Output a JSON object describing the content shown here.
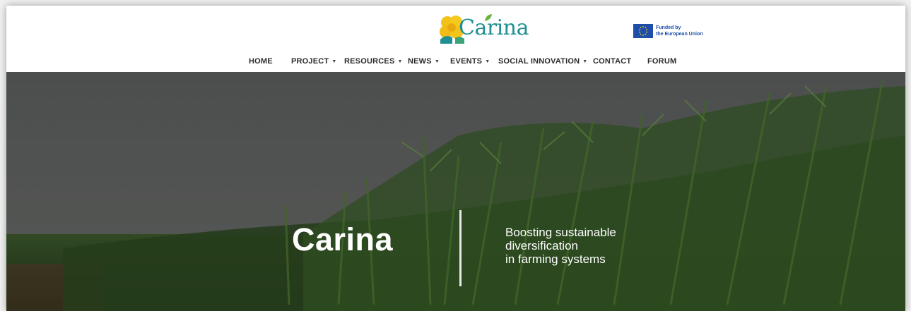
{
  "header": {
    "logo_text": "Carina",
    "eu_badge": {
      "line1": "Funded by",
      "line2": "the European Union"
    }
  },
  "nav": {
    "items": [
      {
        "label": "HOME",
        "dropdown": false
      },
      {
        "label": "PROJECT",
        "dropdown": true
      },
      {
        "label": "RESOURCES",
        "dropdown": true
      },
      {
        "label": "NEWS",
        "dropdown": true
      },
      {
        "label": "EVENTS",
        "dropdown": true
      },
      {
        "label": "SOCIAL INNOVATION",
        "dropdown": true
      },
      {
        "label": "CONTACT",
        "dropdown": false
      },
      {
        "label": "FORUM",
        "dropdown": false
      }
    ]
  },
  "hero": {
    "title": "Carina",
    "tagline": [
      "Boosting sustainable",
      "diversification",
      "in farming systems"
    ]
  },
  "colors": {
    "brand_teal": "#1f8f93",
    "brand_yellow": "#f2c21a",
    "eu_blue": "#1f4ea8",
    "nav_text": "#2b2b2b"
  }
}
